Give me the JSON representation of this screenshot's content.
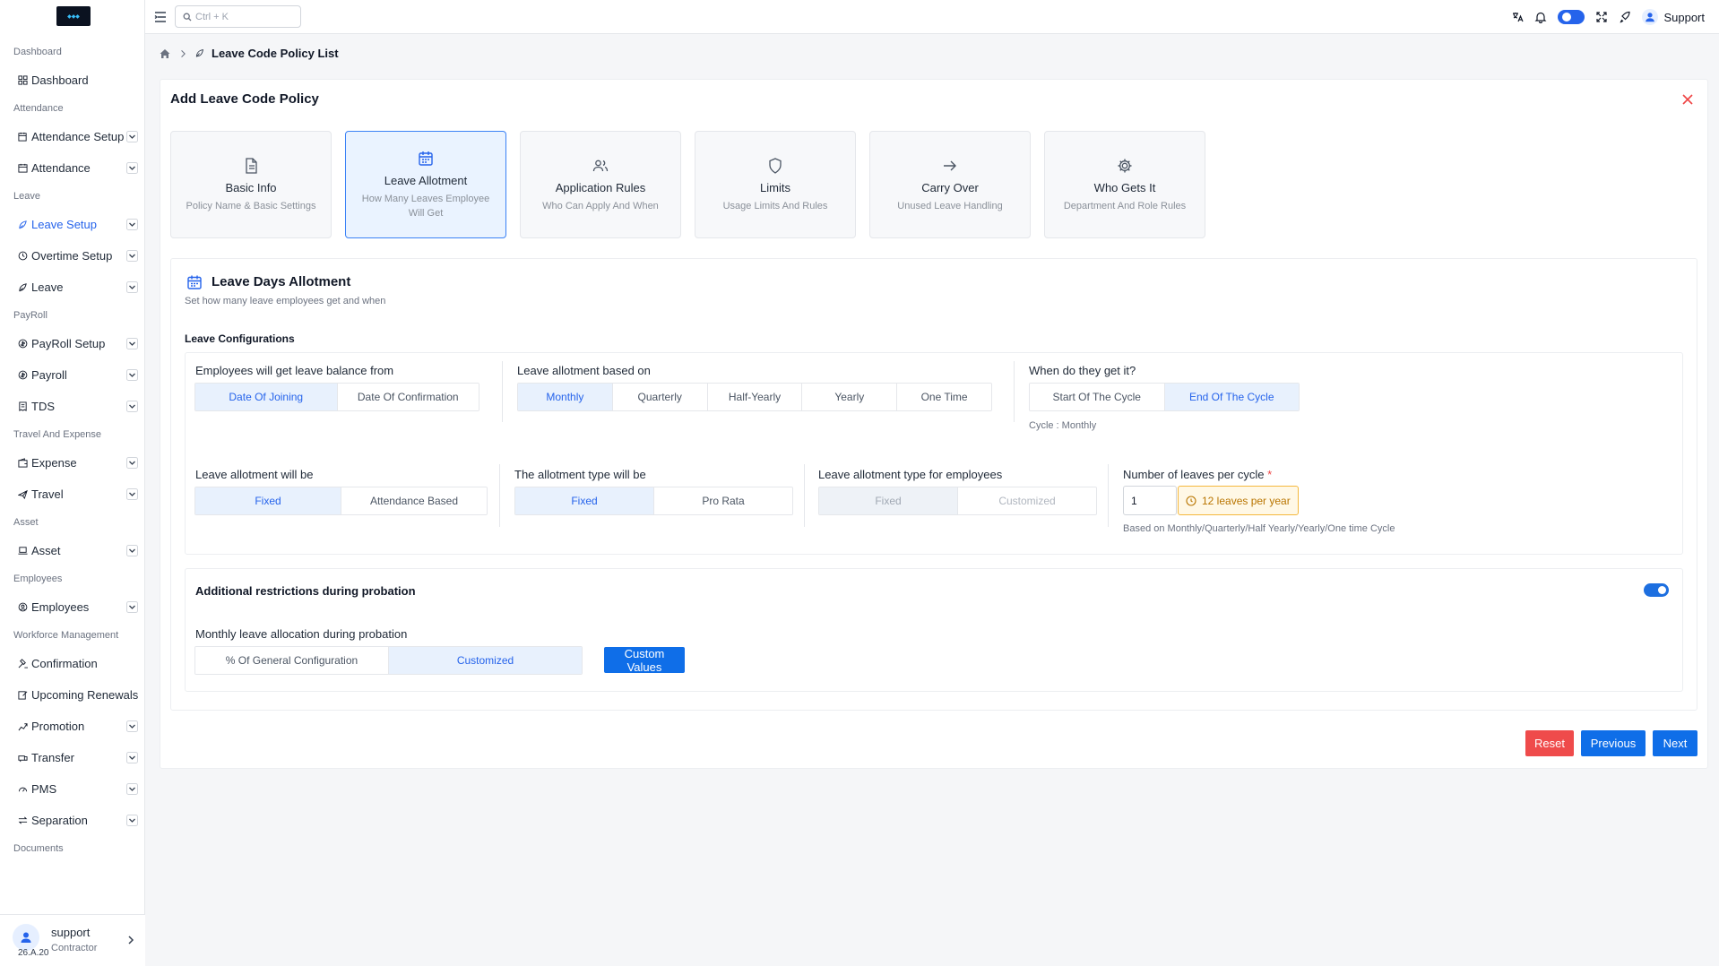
{
  "sidebar": {
    "sections": [
      {
        "title": "Dashboard",
        "items": [
          {
            "label": "Dashboard",
            "icon": "dashboard-icon",
            "chevron": false
          }
        ]
      },
      {
        "title": "Attendance",
        "items": [
          {
            "label": "Attendance Setup",
            "icon": "calendar-cog-icon",
            "chevron": true
          },
          {
            "label": "Attendance",
            "icon": "calendar-icon",
            "chevron": true
          }
        ]
      },
      {
        "title": "Leave",
        "items": [
          {
            "label": "Leave Setup",
            "icon": "leaf-icon",
            "chevron": true,
            "active": true
          },
          {
            "label": "Overtime Setup",
            "icon": "clock-icon",
            "chevron": true
          },
          {
            "label": "Leave",
            "icon": "leaf-icon",
            "chevron": true
          }
        ]
      },
      {
        "title": "PayRoll",
        "items": [
          {
            "label": "PayRoll Setup",
            "icon": "money-cog-icon",
            "chevron": true
          },
          {
            "label": "Payroll",
            "icon": "money-icon",
            "chevron": true
          },
          {
            "label": "TDS",
            "icon": "receipt-icon",
            "chevron": true
          }
        ]
      },
      {
        "title": "Travel And Expense",
        "items": [
          {
            "label": "Expense",
            "icon": "wallet-icon",
            "chevron": true
          },
          {
            "label": "Travel",
            "icon": "plane-icon",
            "chevron": true
          }
        ]
      },
      {
        "title": "Asset",
        "items": [
          {
            "label": "Asset",
            "icon": "laptop-icon",
            "chevron": true
          }
        ]
      },
      {
        "title": "Employees",
        "items": [
          {
            "label": "Employees",
            "icon": "user-circle-icon",
            "chevron": true
          }
        ]
      },
      {
        "title": "Workforce Management",
        "items": [
          {
            "label": "Confirmation",
            "icon": "gavel-icon",
            "chevron": false
          },
          {
            "label": "Upcoming Renewals",
            "icon": "edit-icon",
            "chevron": false
          },
          {
            "label": "Promotion",
            "icon": "chart-up-icon",
            "chevron": true
          },
          {
            "label": "Transfer",
            "icon": "transfer-icon",
            "chevron": true
          },
          {
            "label": "PMS",
            "icon": "gauge-icon",
            "chevron": true
          },
          {
            "label": "Separation",
            "icon": "swap-icon",
            "chevron": true
          }
        ]
      },
      {
        "title": "Documents",
        "items": []
      }
    ],
    "footer": {
      "name": "support",
      "role": "Contractor",
      "version": "26.A.20"
    }
  },
  "topbar": {
    "search_placeholder": "Ctrl + K",
    "user": "Support"
  },
  "breadcrumb": {
    "page": "Leave Code Policy List"
  },
  "card": {
    "title": "Add Leave Code Policy"
  },
  "steps": [
    {
      "label": "Basic Info",
      "sub": "Policy Name & Basic Settings",
      "icon": "document-icon"
    },
    {
      "label": "Leave Allotment",
      "sub": "How Many Leaves Employee Will Get",
      "icon": "calendar-icon",
      "active": true
    },
    {
      "label": "Application Rules",
      "sub": "Who Can Apply And When",
      "icon": "users-icon"
    },
    {
      "label": "Limits",
      "sub": "Usage Limits And Rules",
      "icon": "shield-icon"
    },
    {
      "label": "Carry Over",
      "sub": "Unused Leave Handling",
      "icon": "arrow-right-icon"
    },
    {
      "label": "Who Gets It",
      "sub": "Department And Role Rules",
      "icon": "gear-icon"
    }
  ],
  "panel": {
    "title": "Leave Days Allotment",
    "subtitle": "Set how many leave employees get and when",
    "configurations_label": "Leave Configurations",
    "balance_from": {
      "label": "Employees will get leave balance from",
      "options": [
        "Date Of Joining",
        "Date Of Confirmation"
      ],
      "selected": 0
    },
    "based_on": {
      "label": "Leave allotment based on",
      "options": [
        "Monthly",
        "Quarterly",
        "Half-Yearly",
        "Yearly",
        "One Time"
      ],
      "selected": 0
    },
    "when": {
      "label": "When do they get it?",
      "options": [
        "Start Of The Cycle",
        "End Of The Cycle"
      ],
      "selected": 1,
      "hint": "Cycle : Monthly"
    },
    "will_be": {
      "label": "Leave allotment will be",
      "options": [
        "Fixed",
        "Attendance Based"
      ],
      "selected": 0
    },
    "type_will_be": {
      "label": "The allotment type will be",
      "options": [
        "Fixed",
        "Pro Rata"
      ],
      "selected": 0
    },
    "type_for_employees": {
      "label": "Leave allotment type for employees",
      "options": [
        "Fixed",
        "Customized"
      ],
      "selected": 0
    },
    "leaves_per_cycle": {
      "label": "Number of leaves per cycle",
      "required_mark": "*",
      "value": "1",
      "badge": "12 leaves per year",
      "hint": "Based on Monthly/Quarterly/Half Yearly/Yearly/One time Cycle"
    },
    "probation": {
      "title": "Additional restrictions during probation",
      "enabled": true,
      "allocation_label": "Monthly leave allocation during probation",
      "options": [
        "% Of General Configuration",
        "Customized"
      ],
      "selected": 1,
      "custom_button": "Custom Values"
    }
  },
  "actions": {
    "reset": "Reset",
    "previous": "Previous",
    "next": "Next"
  },
  "colors": {
    "primary": "#0f6ee8",
    "danger": "#ef4b4b",
    "warning": "#f5b83d"
  }
}
